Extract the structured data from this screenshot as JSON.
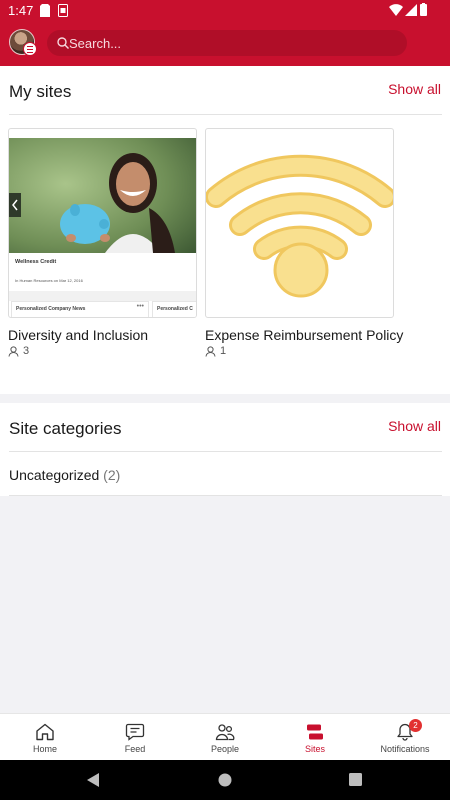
{
  "status_bar": {
    "time": "1:47"
  },
  "header": {
    "search": {
      "placeholder": "Search..."
    }
  },
  "my_sites": {
    "title": "My sites",
    "show_all": "Show all",
    "thumb1": {
      "title": "Wellness Credit",
      "meta": "In Human Resources on Mar 12, 2016",
      "tab1": "Personalized Company News",
      "tab2": "Personalized C"
    },
    "sites": [
      {
        "name": "Diversity and Inclusion",
        "members": "3"
      },
      {
        "name": "Expense Reimbursement Policy",
        "members": "1"
      }
    ]
  },
  "site_categories": {
    "title": "Site categories",
    "show_all": "Show all",
    "items": [
      {
        "name": "Uncategorized",
        "count": "(2)"
      }
    ]
  },
  "bottom_nav": {
    "items": [
      {
        "label": "Home",
        "icon": "home-icon"
      },
      {
        "label": "Feed",
        "icon": "feed-icon"
      },
      {
        "label": "People",
        "icon": "people-icon"
      },
      {
        "label": "Sites",
        "icon": "sites-icon",
        "active": true
      },
      {
        "label": "Notifications",
        "icon": "bell-icon",
        "badge": "2"
      }
    ]
  },
  "colors": {
    "brand": "#c8102e",
    "badge": "#e23030",
    "wifi": "#f5d66a"
  }
}
